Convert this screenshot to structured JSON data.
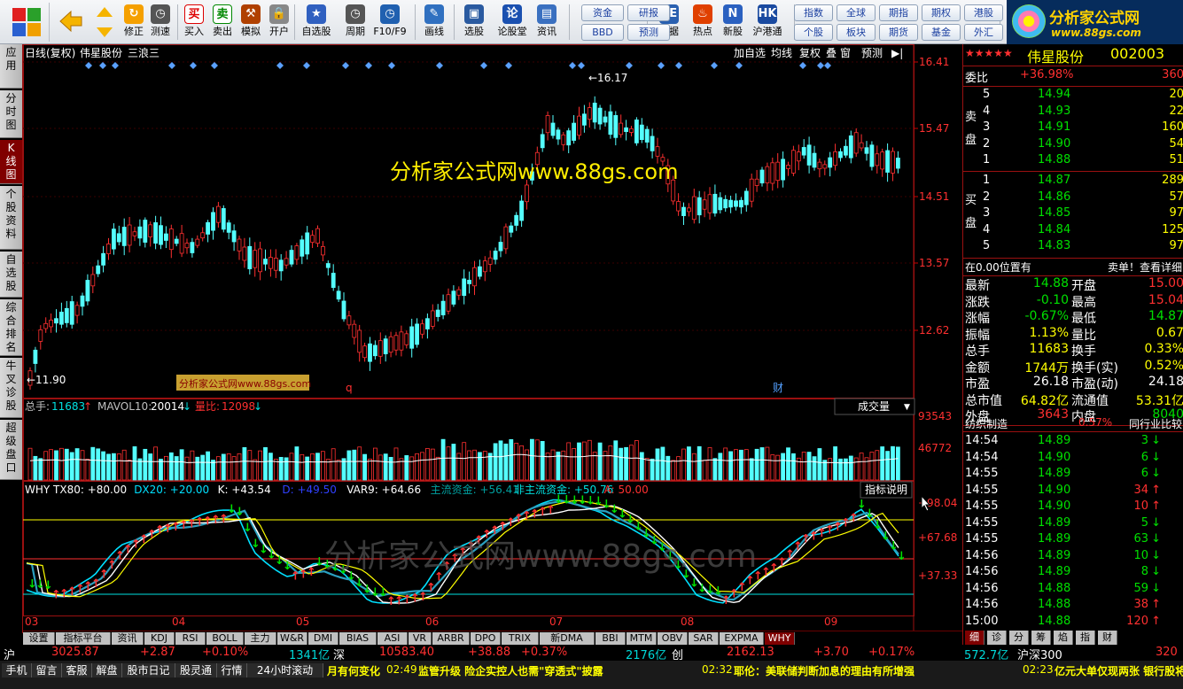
{
  "toolbar": {
    "buttons": [
      {
        "label": "修正",
        "icon": "refresh-icon"
      },
      {
        "label": "测速",
        "icon": "clock-icon"
      },
      {
        "label": "买入",
        "icon": "buy-icon"
      },
      {
        "label": "卖出",
        "icon": "sell-icon"
      },
      {
        "label": "模拟",
        "icon": "hammer-icon"
      },
      {
        "label": "开户",
        "icon": "lock-icon"
      },
      {
        "label": "自选股",
        "icon": "star-icon"
      },
      {
        "label": "周期",
        "icon": "clock-icon"
      },
      {
        "label": "F10/F9",
        "icon": "f10-icon"
      },
      {
        "label": "画线",
        "icon": "pen-icon"
      },
      {
        "label": "选股",
        "icon": "screen-icon"
      },
      {
        "label": "论股堂",
        "icon": "discuss-icon"
      },
      {
        "label": "资讯",
        "icon": "news-icon"
      },
      {
        "label": "数据",
        "icon": "pe-icon"
      },
      {
        "label": "热点",
        "icon": "fire-icon"
      },
      {
        "label": "新股",
        "icon": "newstock-icon"
      },
      {
        "label": "沪港通",
        "icon": "hkconnect-icon"
      }
    ],
    "small_buttons": [
      "资金",
      "研报",
      "BBD",
      "预测",
      "指数",
      "全球",
      "期指",
      "期权",
      "港股",
      "个股",
      "板块",
      "期货",
      "基金",
      "外汇"
    ],
    "logo_title": "分析家公式网",
    "logo_url": "www.88gs.com"
  },
  "left_tabs": [
    "应用",
    "分时图",
    "K线图",
    "个股资料",
    "自选股",
    "综合排名",
    "牛叉诊股",
    "超级盘口"
  ],
  "chart": {
    "header": {
      "period": "日线(复权)",
      "stock": "伟星股份",
      "note": "三浪三"
    },
    "header_buttons": [
      "加自选",
      "均线",
      "复权",
      "叠",
      "窗",
      "预测"
    ],
    "high_label": "16.17",
    "low_label": "11.90",
    "watermark_center": "分析家公式网www.88gs.com",
    "watermark_box": "分析家公式网www.88gs.com",
    "watermark_bottom": "分析家公式网www.88gs.com",
    "marker_q": "q",
    "marker_cai": "财",
    "price_axis": [
      "16.41",
      "15.47",
      "14.51",
      "13.57",
      "12.62"
    ],
    "volume": {
      "label_total": "总手:",
      "total": "11683",
      "label_mavol": "MAVOL10:",
      "mavol": "20014",
      "label_ratio": "量比:",
      "ratio": "12098",
      "dropdown": "成交量",
      "axis": [
        "93543",
        "46772"
      ]
    },
    "why": {
      "items": [
        {
          "text": "WHY TX80: +80.00",
          "color": "#ffffff"
        },
        {
          "text": "DX20: +20.00",
          "color": "#00e0ff"
        },
        {
          "text": "K: +43.54",
          "color": "#ffffff"
        },
        {
          "text": "D: +49.50",
          "color": "#3040ff"
        },
        {
          "text": "VAR9: +64.66",
          "color": "#ffffff"
        },
        {
          "text": "主流资金: +56.41",
          "color": "#00a0a0"
        },
        {
          "text": "非主流资金: +50.76",
          "color": "#00e0e0"
        },
        {
          "text": "A: 50.00",
          "color": "#ff3030"
        }
      ],
      "explain": "指标说明",
      "axis": [
        "+98.04",
        "+67.68",
        "+37.33"
      ]
    },
    "months": [
      "03",
      "04",
      "05",
      "06",
      "07",
      "08",
      "09"
    ]
  },
  "bottom_tabs": [
    "设置",
    "指标平台",
    "资讯",
    "KDJ",
    "RSI",
    "BOLL",
    "主力",
    "W&R",
    "DMI",
    "BIAS",
    "ASI",
    "VR",
    "ARBR",
    "DPO",
    "TRIX",
    "新DMA",
    "BBI",
    "MTM",
    "OBV",
    "SAR",
    "EXPMA",
    "WHY"
  ],
  "right": {
    "stars": "★★★★★",
    "name": "伟星股份",
    "code": "002003",
    "webi_label": "委比",
    "webi": "+36.98%",
    "webi_val": "360",
    "sell_label": "卖盘",
    "buy_label": "买盘",
    "sells": [
      {
        "lvl": "5",
        "price": "14.94",
        "vol": "20"
      },
      {
        "lvl": "4",
        "price": "14.93",
        "vol": "22"
      },
      {
        "lvl": "3",
        "price": "14.91",
        "vol": "160"
      },
      {
        "lvl": "2",
        "price": "14.90",
        "vol": "54"
      },
      {
        "lvl": "1",
        "price": "14.88",
        "vol": "51"
      }
    ],
    "buys": [
      {
        "lvl": "1",
        "price": "14.87",
        "vol": "289"
      },
      {
        "lvl": "2",
        "price": "14.86",
        "vol": "57"
      },
      {
        "lvl": "3",
        "price": "14.85",
        "vol": "97"
      },
      {
        "lvl": "4",
        "price": "14.84",
        "vol": "125"
      },
      {
        "lvl": "5",
        "price": "14.83",
        "vol": "97"
      }
    ],
    "pos_note": "在0.00位置有",
    "pos_link": "卖单！查看详细",
    "quotes": [
      {
        "l1": "最新",
        "v1": "14.88",
        "c1": "#00e000",
        "l2": "开盘",
        "v2": "15.00",
        "c2": "#ff3030"
      },
      {
        "l1": "涨跌",
        "v1": "-0.10",
        "c1": "#00e000",
        "l2": "最高",
        "v2": "15.04",
        "c2": "#ff3030"
      },
      {
        "l1": "涨幅",
        "v1": "-0.67%",
        "c1": "#00e000",
        "l2": "最低",
        "v2": "14.87",
        "c2": "#00e000"
      },
      {
        "l1": "振幅",
        "v1": "1.13%",
        "c1": "#ffff00",
        "l2": "量比",
        "v2": "0.67",
        "c2": "#ffff00"
      },
      {
        "l1": "总手",
        "v1": "11683",
        "c1": "#ffff00",
        "l2": "换手",
        "v2": "0.33%",
        "c2": "#ffff00"
      },
      {
        "l1": "金额",
        "v1": "1744万",
        "c1": "#ffff00",
        "l2": "换手(实)",
        "v2": "0.52%",
        "c2": "#ffff00"
      },
      {
        "l1": "市盈",
        "v1": "26.18",
        "c1": "#ffffff",
        "l2": "市盈(动)",
        "v2": "24.18",
        "c2": "#ffffff"
      },
      {
        "l1": "总市值",
        "v1": "64.82亿",
        "c1": "#ffff00",
        "l2": "流通值",
        "v2": "53.31亿",
        "c2": "#ffff00"
      },
      {
        "l1": "外盘",
        "v1": "3643",
        "c1": "#ff3030",
        "l2": "内盘",
        "v2": "8040",
        "c2": "#00e000"
      }
    ],
    "industry": "纺织制造",
    "industry_pct": "0.57%",
    "industry_cmp": "同行业比较",
    "ticks": [
      {
        "t": "14:54",
        "p": "14.89",
        "v": "3",
        "d": "down"
      },
      {
        "t": "14:54",
        "p": "14.90",
        "v": "6",
        "d": "down"
      },
      {
        "t": "14:55",
        "p": "14.89",
        "v": "6",
        "d": "down"
      },
      {
        "t": "14:55",
        "p": "14.90",
        "v": "34",
        "d": "up"
      },
      {
        "t": "14:55",
        "p": "14.90",
        "v": "10",
        "d": "up"
      },
      {
        "t": "14:55",
        "p": "14.89",
        "v": "5",
        "d": "down"
      },
      {
        "t": "14:55",
        "p": "14.89",
        "v": "63",
        "d": "down"
      },
      {
        "t": "14:56",
        "p": "14.89",
        "v": "10",
        "d": "down"
      },
      {
        "t": "14:56",
        "p": "14.89",
        "v": "8",
        "d": "down"
      },
      {
        "t": "14:56",
        "p": "14.88",
        "v": "59",
        "d": "down"
      },
      {
        "t": "14:56",
        "p": "14.88",
        "v": "38",
        "d": "up"
      },
      {
        "t": "15:00",
        "p": "14.88",
        "v": "120",
        "d": "up"
      }
    ],
    "tabs": [
      "细",
      "诊",
      "分",
      "筹",
      "焰",
      "指",
      "财"
    ]
  },
  "status": {
    "sh_label": "沪",
    "sh_index": "3025.87",
    "sh_chg": "+2.87",
    "sh_pct": "+0.10%",
    "sh_amt": "1341亿",
    "sz_label": "深",
    "sz_index": "10583.40",
    "sz_chg": "+38.88",
    "sz_pct": "+0.37%",
    "sz_amt": "2176亿",
    "cy_label": "创",
    "cy_index": "2162.13",
    "cy_chg": "+3.70",
    "cy_pct": "+0.17%",
    "hsz_amt": "572.7亿",
    "hsz_label": "沪深300",
    "hsz_tail": "320"
  },
  "bottom_buttons": [
    "手机",
    "留言",
    "客服",
    "解盘",
    "股市日记",
    "股灵通",
    "行情",
    "24小时滚动"
  ],
  "news": [
    {
      "time": "",
      "text": "月有何变化"
    },
    {
      "time": "02:49",
      "text": "监管升级 险企实控人也需\"穿透式\"披露"
    },
    {
      "time": "02:32",
      "text": "耶伦：美联储判断加息的理由有所增强"
    },
    {
      "time": "02:23",
      "text": "亿元大单仅现两张 银行股将"
    }
  ]
}
